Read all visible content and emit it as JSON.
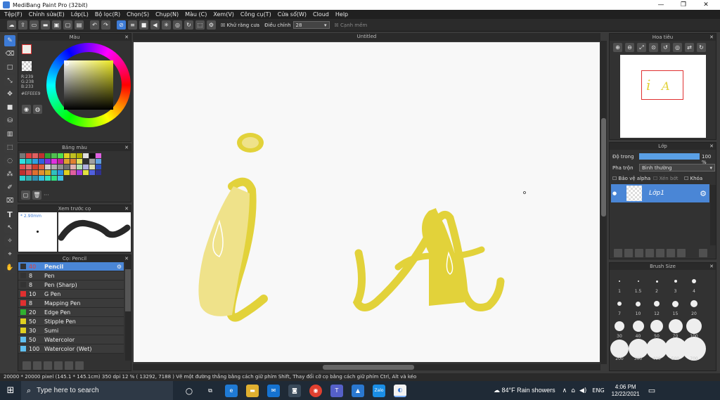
{
  "window": {
    "title": "MediBang Paint Pro (32bit)"
  },
  "menu": [
    "Tệp(F)",
    "Chỉnh sửa(E)",
    "Lớp(L)",
    "Bộ lọc(R)",
    "Chọn(S)",
    "Chụp(N)",
    "Màu (C)",
    "Xem(V)",
    "Công cụ(T)",
    "Cửa sổ(W)",
    "Cloud",
    "Help"
  ],
  "toolbar": {
    "antialias_label": "Khử răng cưa",
    "adjust_label": "Điều chỉnh",
    "adjust_value": "28",
    "smooth_label": "Cạnh mềm"
  },
  "color_panel": {
    "title": "Màu",
    "r": "R:239",
    "g": "G:238",
    "b": "B:233",
    "hex": "#EFEEE9"
  },
  "palette_panel": {
    "title": "Bảng màu",
    "more": "···"
  },
  "preview_panel": {
    "title": "Xem trước cọ",
    "size": "* 2.90mm"
  },
  "brush_panel": {
    "title": "Cọ: Pencil",
    "items": [
      {
        "size": "40",
        "name": "Pencil",
        "color": "#333333",
        "selected": true
      },
      {
        "size": "8",
        "name": "Pen",
        "color": "#333333"
      },
      {
        "size": "8",
        "name": "Pen (Sharp)",
        "color": "#333333"
      },
      {
        "size": "10",
        "name": "G Pen",
        "color": "#e03030"
      },
      {
        "size": "8",
        "name": "Mapping Pen",
        "color": "#e03030"
      },
      {
        "size": "20",
        "name": "Edge Pen",
        "color": "#30b030"
      },
      {
        "size": "50",
        "name": "Stipple Pen",
        "color": "#e0d020"
      },
      {
        "size": "30",
        "name": "Sumi",
        "color": "#e0d020"
      },
      {
        "size": "50",
        "name": "Watercolor",
        "color": "#60c0f0"
      },
      {
        "size": "100",
        "name": "Watercolor (Wet)",
        "color": "#60c0f0"
      }
    ]
  },
  "document": {
    "tab": "Untitled"
  },
  "navigator": {
    "title": "Hoa tiêu"
  },
  "layer_panel": {
    "title": "Lớp",
    "opacity_label": "Độ trong",
    "opacity_value": "100 %",
    "blend_label": "Pha trộn",
    "blend_value": "Bình thường",
    "alpha_label": "Bảo vệ alpha",
    "clip_label": "Xén bớt",
    "lock_label": "Khóa",
    "layer_name": "Lớp1"
  },
  "brush_size_panel": {
    "title": "Brush Size",
    "sizes": [
      "1",
      "1.5",
      "2",
      "3",
      "4",
      "7",
      "10",
      "12",
      "15",
      "20",
      "30",
      "40",
      "50",
      "70",
      "100",
      "200",
      "300",
      "400",
      "500",
      "700"
    ]
  },
  "status": {
    "text": "20000 * 20000 pixel   (145.1 * 145.1cm)   350 dpi   12 %   ( 13292, 7188 )   Vẽ một đường thẳng bằng cách giữ phím Shift, Thay đổi cỡ cọ bằng cách giữ phím Ctrl, Alt và kéo"
  },
  "taskbar": {
    "search_placeholder": "Type here to search",
    "weather": "84°F  Rain showers",
    "lang": "ENG",
    "time": "4:06 PM",
    "date": "12/22/2021"
  },
  "colors": {
    "accent": "#3d7bd6",
    "stroke_yellow": "#e2d23a"
  }
}
